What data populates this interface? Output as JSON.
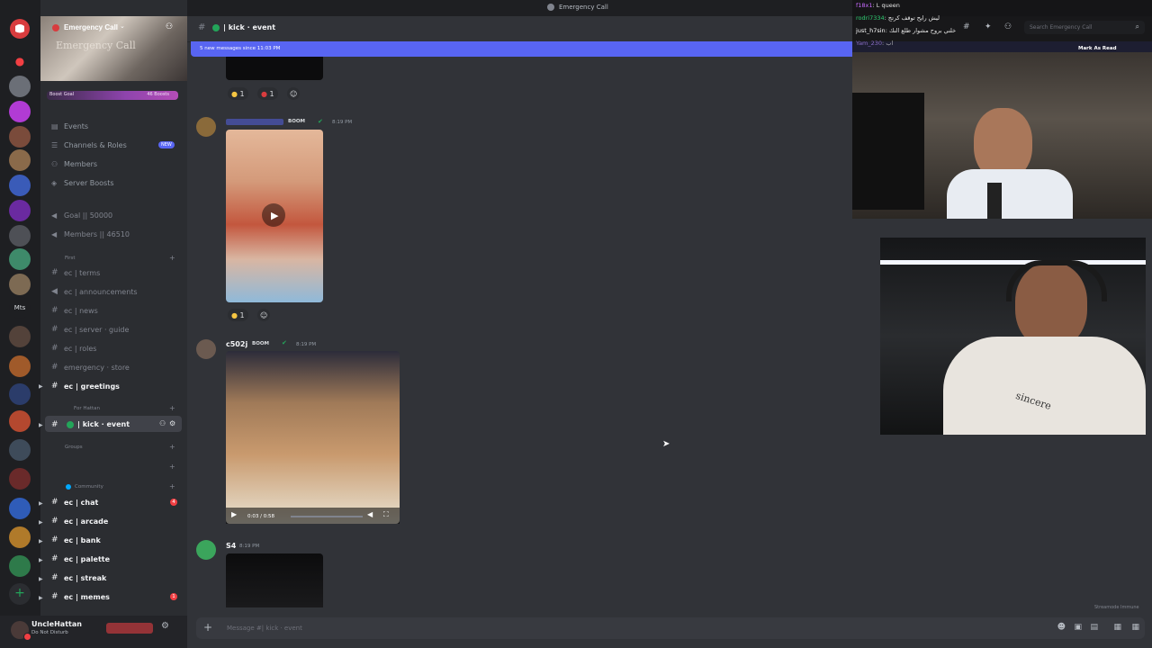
{
  "window": {
    "title": "Emergency Call"
  },
  "server": {
    "name": "Emergency Call",
    "banner_text": "Emergency Call",
    "boost_goal_label": "Boost Goal",
    "boost_count": "46 Boosts"
  },
  "rail": {
    "mts_label": "Mts"
  },
  "sidebar": {
    "nav": [
      {
        "label": "Events"
      },
      {
        "label": "Channels & Roles",
        "badge": "NEW"
      },
      {
        "label": "Members"
      },
      {
        "label": "Server Boosts"
      }
    ],
    "stats": [
      {
        "label": "Goal || 50000"
      },
      {
        "label": "Members || 46510"
      }
    ],
    "category_first": "First",
    "channels_first": [
      {
        "label": "ec | terms"
      },
      {
        "label": "ec | announcements"
      },
      {
        "label": "ec | news"
      },
      {
        "label": "ec | server · guide"
      },
      {
        "label": "ec | roles"
      },
      {
        "label": "emergency · store"
      },
      {
        "label": "ec | greetings"
      }
    ],
    "category_hattan": "For Hattan",
    "active_channel": "| kick · event",
    "category_groups": "Groups",
    "category_community": "Community",
    "channels_community": [
      {
        "label": "ec | chat",
        "badge": "4"
      },
      {
        "label": "ec | arcade"
      },
      {
        "label": "ec | bank"
      },
      {
        "label": "ec | palette"
      },
      {
        "label": "ec | streak"
      },
      {
        "label": "ec | memes",
        "badge": "1"
      }
    ]
  },
  "user": {
    "name": "UncleHattan",
    "status": "Do Not Disturb"
  },
  "channel_header": {
    "name": "| kick · event"
  },
  "new_messages_bar": {
    "text": "5 new messages since 11:03 PM",
    "action": "Mark As Read"
  },
  "search": {
    "placeholder": "Search Emergency Call"
  },
  "messages": [
    {
      "author": "",
      "badge": "BOOM",
      "time": "8:19 PM"
    },
    {
      "author": "c502j",
      "badge": "BOOM",
      "time": "8:19 PM",
      "video_time": "0:03 / 0:58"
    },
    {
      "author": "S4",
      "time": "8:19 PM"
    }
  ],
  "reactions": {
    "first": [
      {
        "count": "1"
      },
      {
        "count": "1"
      }
    ],
    "second": [
      {
        "count": "1"
      }
    ]
  },
  "composer": {
    "placeholder": "Message #| kick · event"
  },
  "stream_chat": [
    {
      "user": "f18x1",
      "text": ": L queen",
      "color": "#c86bff"
    },
    {
      "user": "rodri7334",
      "text": ": ليش رايح توقف كرتج",
      "color": "#2ecc71"
    },
    {
      "user": "",
      "text": "خلني بروح مشوار طلع النك",
      "color": "#ffffff"
    },
    {
      "user": "just_h7sin",
      "text": ": خلني بروح مشوار طلع النك",
      "color": "#ffffff"
    },
    {
      "user": "Yam_230",
      "text": ": اب",
      "color": "#b48cff"
    }
  ],
  "cam2": {
    "shirt_text": "sincere"
  },
  "watermark": "Streamode Immune",
  "colors": {
    "accent": "#5865f2",
    "danger": "#f23f43",
    "online": "#23a55a",
    "boost": "#b44db7"
  }
}
